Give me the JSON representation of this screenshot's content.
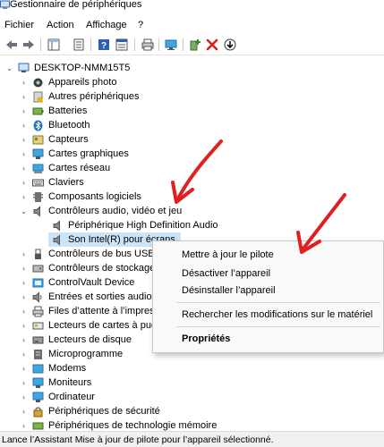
{
  "window": {
    "title": "Gestionnaire de périphériques"
  },
  "menu": [
    "Fichier",
    "Action",
    "Affichage",
    "?"
  ],
  "toolbar": {
    "buttons": [
      "back-icon",
      "forward-icon",
      "tree-view-icon",
      "properties-icon",
      "help-icon",
      "details-icon",
      "print-icon",
      "monitor-icon",
      "add-driver-icon",
      "uninstall-x-icon",
      "download-icon"
    ]
  },
  "tree": {
    "root": "DESKTOP-NMM15T5",
    "categories": [
      "Appareils photo",
      "Autres périphériques",
      "Batteries",
      "Bluetooth",
      "Capteurs",
      "Cartes graphiques",
      "Cartes réseau",
      "Claviers",
      "Composants logiciels",
      "Contrôleurs audio, vidéo et jeu",
      "Contrôleurs de bus USB",
      "Contrôleurs de stockage",
      "ControlVault Device",
      "Entrées et sorties audio",
      "Files d’attente à l’impres",
      "Lecteurs de cartes à puce",
      "Lecteurs de disque",
      "Microprogramme",
      "Modems",
      "Moniteurs",
      "Ordinateur",
      "Périphériques de sécurité",
      "Périphériques de technologie mémoire"
    ],
    "audio_children": [
      "Périphérique High Definition Audio",
      "Son Intel(R) pour écrans"
    ]
  },
  "context_menu": {
    "update": "Mettre à jour le pilote",
    "disable": "Désactiver l’appareil",
    "uninstall": "Désinstaller l’appareil",
    "scan": "Rechercher les modifications sur le matériel",
    "properties": "Propriétés"
  },
  "status": "Lance l’Assistant Mise à jour de pilote pour l’appareil sélectionné.",
  "colors": {
    "selection": "#cce4f7",
    "arrow": "#e02020",
    "statusbar": "#f0f0f0"
  }
}
